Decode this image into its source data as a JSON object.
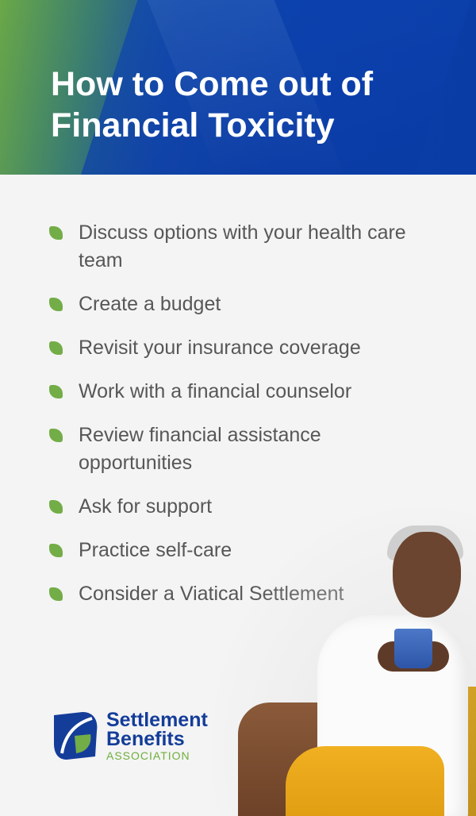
{
  "title": "How to Come out of Financial Toxicity",
  "items": [
    {
      "label": "Discuss options with your health care team"
    },
    {
      "label": "Create a budget"
    },
    {
      "label": "Revisit your insurance coverage"
    },
    {
      "label": "Work with a financial counselor"
    },
    {
      "label": "Review financial assistance opportunities"
    },
    {
      "label": "Ask for support"
    },
    {
      "label": "Practice self-care"
    },
    {
      "label": "Consider a Viatical Settlement"
    }
  ],
  "logo": {
    "line1": "Settlement",
    "line2": "Benefits",
    "sub": "ASSOCIATION"
  },
  "colors": {
    "brand_blue": "#143d9a",
    "brand_green": "#73ad47",
    "text": "#575757"
  },
  "icons": {
    "bullet": "leaf-icon",
    "logo": "leaf-logo-icon"
  }
}
